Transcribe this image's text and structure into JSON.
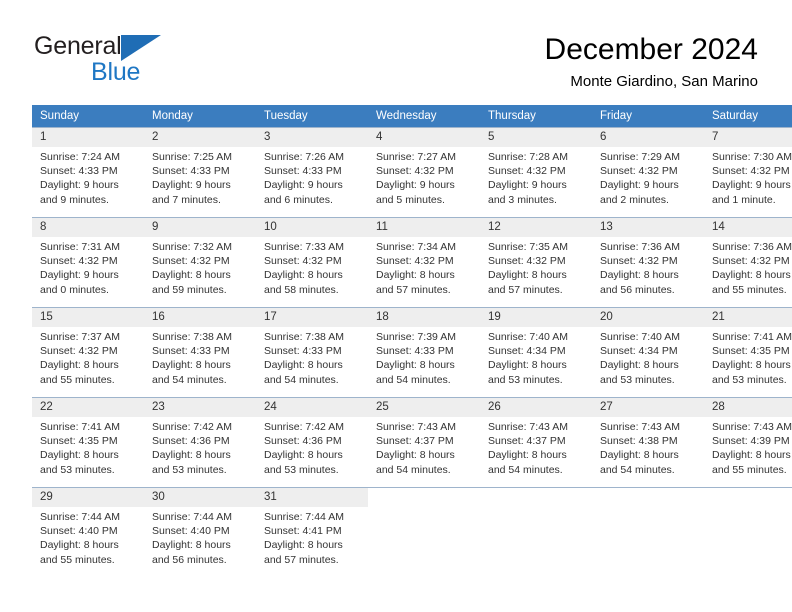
{
  "logo": {
    "word_one": "General",
    "word_two": "Blue",
    "triangle_color": "#1f6db5",
    "blue_color": "#1f77c4"
  },
  "header": {
    "title": "December 2024",
    "subtitle": "Monte Giardino, San Marino"
  },
  "calendar": {
    "header_bg": "#3b7dbf",
    "daynum_bg": "#eeeeee",
    "weekdays": [
      "Sunday",
      "Monday",
      "Tuesday",
      "Wednesday",
      "Thursday",
      "Friday",
      "Saturday"
    ],
    "weeks": [
      [
        {
          "day": "1",
          "sunrise": "Sunrise: 7:24 AM",
          "sunset": "Sunset: 4:33 PM",
          "daylight_1": "Daylight: 9 hours",
          "daylight_2": "and 9 minutes."
        },
        {
          "day": "2",
          "sunrise": "Sunrise: 7:25 AM",
          "sunset": "Sunset: 4:33 PM",
          "daylight_1": "Daylight: 9 hours",
          "daylight_2": "and 7 minutes."
        },
        {
          "day": "3",
          "sunrise": "Sunrise: 7:26 AM",
          "sunset": "Sunset: 4:33 PM",
          "daylight_1": "Daylight: 9 hours",
          "daylight_2": "and 6 minutes."
        },
        {
          "day": "4",
          "sunrise": "Sunrise: 7:27 AM",
          "sunset": "Sunset: 4:32 PM",
          "daylight_1": "Daylight: 9 hours",
          "daylight_2": "and 5 minutes."
        },
        {
          "day": "5",
          "sunrise": "Sunrise: 7:28 AM",
          "sunset": "Sunset: 4:32 PM",
          "daylight_1": "Daylight: 9 hours",
          "daylight_2": "and 3 minutes."
        },
        {
          "day": "6",
          "sunrise": "Sunrise: 7:29 AM",
          "sunset": "Sunset: 4:32 PM",
          "daylight_1": "Daylight: 9 hours",
          "daylight_2": "and 2 minutes."
        },
        {
          "day": "7",
          "sunrise": "Sunrise: 7:30 AM",
          "sunset": "Sunset: 4:32 PM",
          "daylight_1": "Daylight: 9 hours",
          "daylight_2": "and 1 minute."
        }
      ],
      [
        {
          "day": "8",
          "sunrise": "Sunrise: 7:31 AM",
          "sunset": "Sunset: 4:32 PM",
          "daylight_1": "Daylight: 9 hours",
          "daylight_2": "and 0 minutes."
        },
        {
          "day": "9",
          "sunrise": "Sunrise: 7:32 AM",
          "sunset": "Sunset: 4:32 PM",
          "daylight_1": "Daylight: 8 hours",
          "daylight_2": "and 59 minutes."
        },
        {
          "day": "10",
          "sunrise": "Sunrise: 7:33 AM",
          "sunset": "Sunset: 4:32 PM",
          "daylight_1": "Daylight: 8 hours",
          "daylight_2": "and 58 minutes."
        },
        {
          "day": "11",
          "sunrise": "Sunrise: 7:34 AM",
          "sunset": "Sunset: 4:32 PM",
          "daylight_1": "Daylight: 8 hours",
          "daylight_2": "and 57 minutes."
        },
        {
          "day": "12",
          "sunrise": "Sunrise: 7:35 AM",
          "sunset": "Sunset: 4:32 PM",
          "daylight_1": "Daylight: 8 hours",
          "daylight_2": "and 57 minutes."
        },
        {
          "day": "13",
          "sunrise": "Sunrise: 7:36 AM",
          "sunset": "Sunset: 4:32 PM",
          "daylight_1": "Daylight: 8 hours",
          "daylight_2": "and 56 minutes."
        },
        {
          "day": "14",
          "sunrise": "Sunrise: 7:36 AM",
          "sunset": "Sunset: 4:32 PM",
          "daylight_1": "Daylight: 8 hours",
          "daylight_2": "and 55 minutes."
        }
      ],
      [
        {
          "day": "15",
          "sunrise": "Sunrise: 7:37 AM",
          "sunset": "Sunset: 4:32 PM",
          "daylight_1": "Daylight: 8 hours",
          "daylight_2": "and 55 minutes."
        },
        {
          "day": "16",
          "sunrise": "Sunrise: 7:38 AM",
          "sunset": "Sunset: 4:33 PM",
          "daylight_1": "Daylight: 8 hours",
          "daylight_2": "and 54 minutes."
        },
        {
          "day": "17",
          "sunrise": "Sunrise: 7:38 AM",
          "sunset": "Sunset: 4:33 PM",
          "daylight_1": "Daylight: 8 hours",
          "daylight_2": "and 54 minutes."
        },
        {
          "day": "18",
          "sunrise": "Sunrise: 7:39 AM",
          "sunset": "Sunset: 4:33 PM",
          "daylight_1": "Daylight: 8 hours",
          "daylight_2": "and 54 minutes."
        },
        {
          "day": "19",
          "sunrise": "Sunrise: 7:40 AM",
          "sunset": "Sunset: 4:34 PM",
          "daylight_1": "Daylight: 8 hours",
          "daylight_2": "and 53 minutes."
        },
        {
          "day": "20",
          "sunrise": "Sunrise: 7:40 AM",
          "sunset": "Sunset: 4:34 PM",
          "daylight_1": "Daylight: 8 hours",
          "daylight_2": "and 53 minutes."
        },
        {
          "day": "21",
          "sunrise": "Sunrise: 7:41 AM",
          "sunset": "Sunset: 4:35 PM",
          "daylight_1": "Daylight: 8 hours",
          "daylight_2": "and 53 minutes."
        }
      ],
      [
        {
          "day": "22",
          "sunrise": "Sunrise: 7:41 AM",
          "sunset": "Sunset: 4:35 PM",
          "daylight_1": "Daylight: 8 hours",
          "daylight_2": "and 53 minutes."
        },
        {
          "day": "23",
          "sunrise": "Sunrise: 7:42 AM",
          "sunset": "Sunset: 4:36 PM",
          "daylight_1": "Daylight: 8 hours",
          "daylight_2": "and 53 minutes."
        },
        {
          "day": "24",
          "sunrise": "Sunrise: 7:42 AM",
          "sunset": "Sunset: 4:36 PM",
          "daylight_1": "Daylight: 8 hours",
          "daylight_2": "and 53 minutes."
        },
        {
          "day": "25",
          "sunrise": "Sunrise: 7:43 AM",
          "sunset": "Sunset: 4:37 PM",
          "daylight_1": "Daylight: 8 hours",
          "daylight_2": "and 54 minutes."
        },
        {
          "day": "26",
          "sunrise": "Sunrise: 7:43 AM",
          "sunset": "Sunset: 4:37 PM",
          "daylight_1": "Daylight: 8 hours",
          "daylight_2": "and 54 minutes."
        },
        {
          "day": "27",
          "sunrise": "Sunrise: 7:43 AM",
          "sunset": "Sunset: 4:38 PM",
          "daylight_1": "Daylight: 8 hours",
          "daylight_2": "and 54 minutes."
        },
        {
          "day": "28",
          "sunrise": "Sunrise: 7:43 AM",
          "sunset": "Sunset: 4:39 PM",
          "daylight_1": "Daylight: 8 hours",
          "daylight_2": "and 55 minutes."
        }
      ],
      [
        {
          "day": "29",
          "sunrise": "Sunrise: 7:44 AM",
          "sunset": "Sunset: 4:40 PM",
          "daylight_1": "Daylight: 8 hours",
          "daylight_2": "and 55 minutes."
        },
        {
          "day": "30",
          "sunrise": "Sunrise: 7:44 AM",
          "sunset": "Sunset: 4:40 PM",
          "daylight_1": "Daylight: 8 hours",
          "daylight_2": "and 56 minutes."
        },
        {
          "day": "31",
          "sunrise": "Sunrise: 7:44 AM",
          "sunset": "Sunset: 4:41 PM",
          "daylight_1": "Daylight: 8 hours",
          "daylight_2": "and 57 minutes."
        },
        {
          "day": "",
          "sunrise": "",
          "sunset": "",
          "daylight_1": "",
          "daylight_2": ""
        },
        {
          "day": "",
          "sunrise": "",
          "sunset": "",
          "daylight_1": "",
          "daylight_2": ""
        },
        {
          "day": "",
          "sunrise": "",
          "sunset": "",
          "daylight_1": "",
          "daylight_2": ""
        },
        {
          "day": "",
          "sunrise": "",
          "sunset": "",
          "daylight_1": "",
          "daylight_2": ""
        }
      ]
    ]
  }
}
